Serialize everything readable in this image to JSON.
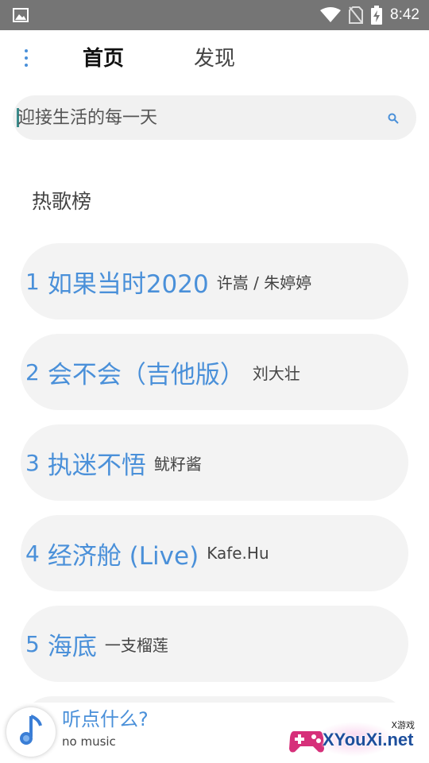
{
  "status_bar": {
    "time": "8:42",
    "icons": [
      "image-icon",
      "wifi-icon",
      "no-sim-icon",
      "battery-charging-icon"
    ]
  },
  "nav": {
    "tabs": [
      {
        "label": "首页",
        "active": true
      },
      {
        "label": "发现",
        "active": false
      }
    ],
    "menu_icon": "more-vert-icon"
  },
  "search": {
    "placeholder": "迎接生活的每一天",
    "icon": "search-icon"
  },
  "section": {
    "title": "热歌榜"
  },
  "songs": [
    {
      "rank": "1",
      "title": "如果当时2020",
      "artist": "许嵩 / 朱婷婷"
    },
    {
      "rank": "2",
      "title": "会不会（吉他版）",
      "artist": "刘大壮"
    },
    {
      "rank": "3",
      "title": "执迷不悟",
      "artist": "鱿籽酱"
    },
    {
      "rank": "4",
      "title": "经济舱 (Live)",
      "artist": "Kafe.Hu"
    },
    {
      "rank": "5",
      "title": "海底",
      "artist": "一支榴莲"
    }
  ],
  "player": {
    "title": "听点什么?",
    "subtitle": "no music",
    "icon": "music-note-icon"
  },
  "watermark": {
    "text": "XYouXi.net",
    "sub": "X游戏"
  },
  "colors": {
    "accent": "#4a90d9",
    "status_bar": "#757575",
    "item_bg": "#f3f3f3"
  }
}
